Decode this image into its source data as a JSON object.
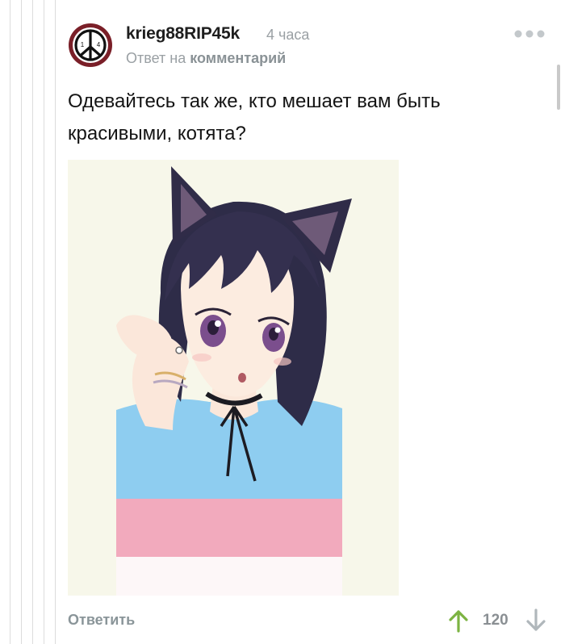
{
  "comment": {
    "author": "krieg88RIP45k",
    "time": "4 часа",
    "reply_prefix": "Ответ на",
    "reply_link": "комментарий",
    "text": "Одевайтесь так же, кто мешает вам быть красивыми, котята?",
    "avatar_digits": [
      "1",
      "4"
    ],
    "image_icon": "anime-catgirl-illustration",
    "more_icon": "more-dots-icon"
  },
  "footer": {
    "reply_label": "Ответить",
    "rating": "120",
    "upvote_color": "#7cb342",
    "downvote_color": "#b0b7bb"
  },
  "colors": {
    "muted": "#9aa0a4",
    "text": "#141414",
    "shirt_blue": "#8ecdf0",
    "shirt_pink": "#f2aabd",
    "image_bg": "#f7f7ea"
  }
}
